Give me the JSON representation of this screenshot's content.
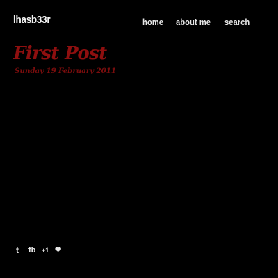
{
  "site": {
    "title": "lhasb33r"
  },
  "nav": {
    "items": [
      {
        "label": "home"
      },
      {
        "label": "about me"
      },
      {
        "label": "search"
      }
    ]
  },
  "post": {
    "title": "First Post",
    "date": "Sunday 19 February 2011"
  },
  "social": {
    "tumblr": "t",
    "facebook": "fb",
    "plusone": "+1",
    "heart": "❤"
  },
  "colors": {
    "background": "#000000",
    "accent": "#8e0f0f",
    "text": "#e6e6e6"
  }
}
